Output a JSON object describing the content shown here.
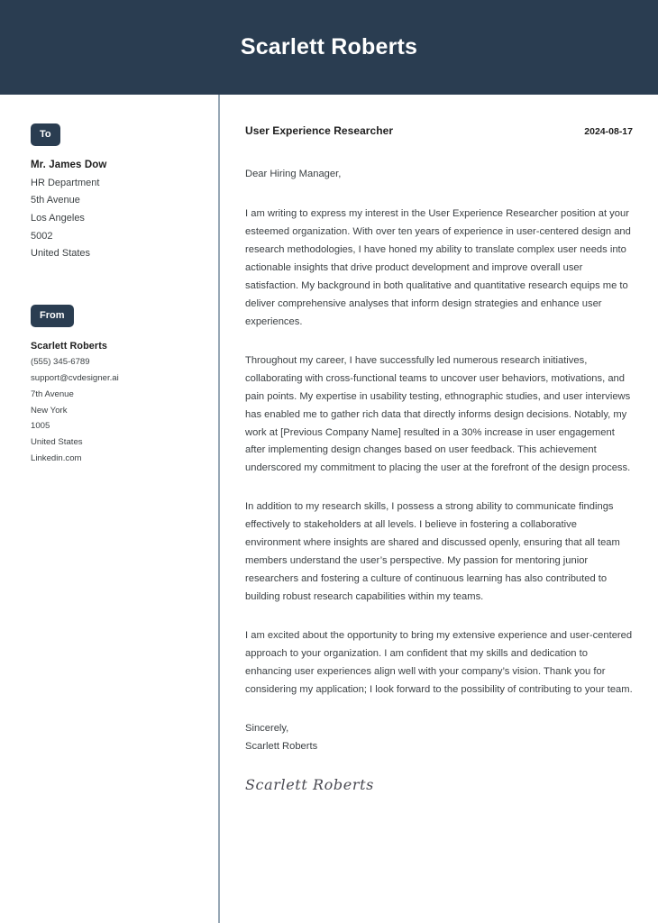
{
  "header": {
    "name": "Scarlett Roberts"
  },
  "colors": {
    "header_background": "#2a3d51",
    "badge_background": "#2a3d51",
    "divider": "#97a7b5",
    "body_text": "#3c4144",
    "heading_text": "#1d1d1d"
  },
  "sidebar": {
    "to": {
      "badge_label": "To",
      "name": "Mr. James Dow",
      "lines": [
        "HR Department",
        "5th Avenue",
        "Los Angeles",
        "5002",
        "United States"
      ]
    },
    "from": {
      "badge_label": "From",
      "name": "Scarlett Roberts",
      "lines": [
        "(555) 345-6789",
        "support@cvdesigner.ai",
        "7th Avenue",
        "New York",
        "1005",
        "United States",
        "Linkedin.com"
      ]
    }
  },
  "main": {
    "job_title": "User Experience Researcher",
    "date": "2024-08-17",
    "salutation": "Dear Hiring Manager,",
    "paragraphs": [
      "I am writing to express my interest in the User Experience Researcher position at your esteemed organization. With over ten years of experience in user-centered design and research methodologies, I have honed my ability to translate complex user needs into actionable insights that drive product development and improve overall user satisfaction. My background in both qualitative and quantitative research equips me to deliver comprehensive analyses that inform design strategies and enhance user experiences.",
      "Throughout my career, I have successfully led numerous research initiatives, collaborating with cross-functional teams to uncover user behaviors, motivations, and pain points. My expertise in usability testing, ethnographic studies, and user interviews has enabled me to gather rich data that directly informs design decisions. Notably, my work at [Previous Company Name] resulted in a 30% increase in user engagement after implementing design changes based on user feedback. This achievement underscored my commitment to placing the user at the forefront of the design process.",
      "In addition to my research skills, I possess a strong ability to communicate findings effectively to stakeholders at all levels. I believe in fostering a collaborative environment where insights are shared and discussed openly, ensuring that all team members understand the user’s perspective. My passion for mentoring junior researchers and fostering a culture of continuous learning has also contributed to building robust research capabilities within my teams.",
      "I am excited about the opportunity to bring my extensive experience and user-centered approach to your organization. I am confident that my skills and dedication to enhancing user experiences align well with your company’s vision. Thank you for considering my application; I look forward to the possibility of contributing to your team."
    ],
    "closing_word": "Sincerely,",
    "closing_name": "Scarlett Roberts",
    "signature": "Scarlett Roberts"
  }
}
